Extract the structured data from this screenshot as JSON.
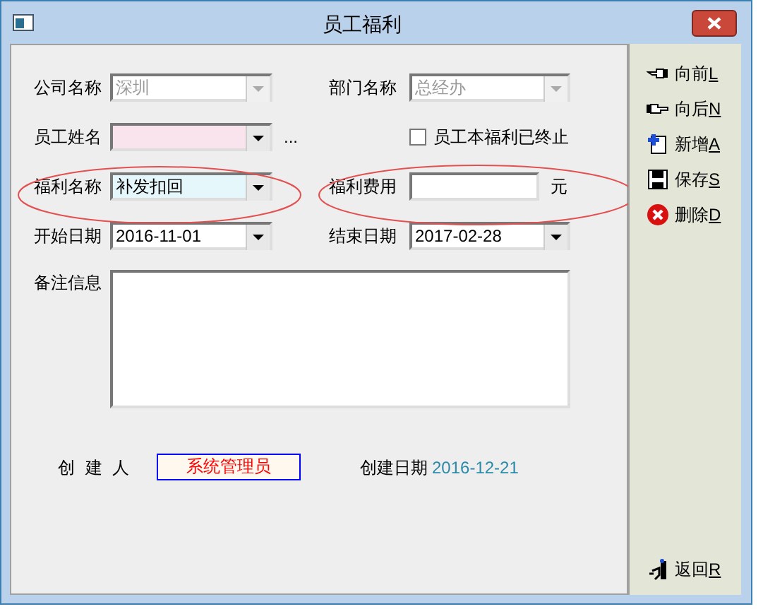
{
  "window": {
    "title": "员工福利"
  },
  "form": {
    "rows": [
      {
        "kind": "pair",
        "left": {
          "label": "公司名称",
          "value": "深圳",
          "disabled": true,
          "color": "#ffffff"
        },
        "right": {
          "kind": "combo",
          "label": "部门名称",
          "value": "总经办",
          "disabled": true
        }
      },
      {
        "kind": "pair",
        "left": {
          "label": "员工姓名",
          "disabled": false,
          "color": "#f9e4ee",
          "more": "..."
        },
        "right": {
          "kind": "checkbox",
          "label": "员工本福利已终止",
          "checked": false
        }
      },
      {
        "kind": "pair",
        "left": {
          "label": "福利名称",
          "value": "补发扣回",
          "disabled": false,
          "color": "#e6f7fc"
        },
        "right": {
          "kind": "text",
          "label": "福利费用",
          "unit": "元"
        }
      },
      {
        "kind": "pair",
        "left": {
          "label": "开始日期",
          "value": "2016-11-01",
          "disabled": false,
          "color": "#ffffff"
        },
        "right": {
          "kind": "combo",
          "label": "结束日期",
          "value": "2017-02-28",
          "disabled": false
        }
      }
    ],
    "remark": {
      "label": "备注信息"
    },
    "creator": {
      "label": "创 建 人",
      "value": "系统管理员"
    },
    "created_date": {
      "label": "创建日期",
      "value": "2016-12-21"
    }
  },
  "toolbar": [
    {
      "kind": "prev",
      "label": "向前",
      "key": "L"
    },
    {
      "kind": "next",
      "label": "向后",
      "key": "N"
    },
    {
      "kind": "add",
      "label": "新增",
      "key": "A"
    },
    {
      "kind": "save",
      "label": "保存",
      "key": "S"
    },
    {
      "kind": "delete",
      "label": "删除",
      "key": "D"
    }
  ],
  "return_button": {
    "label": "返回",
    "key": "R"
  }
}
